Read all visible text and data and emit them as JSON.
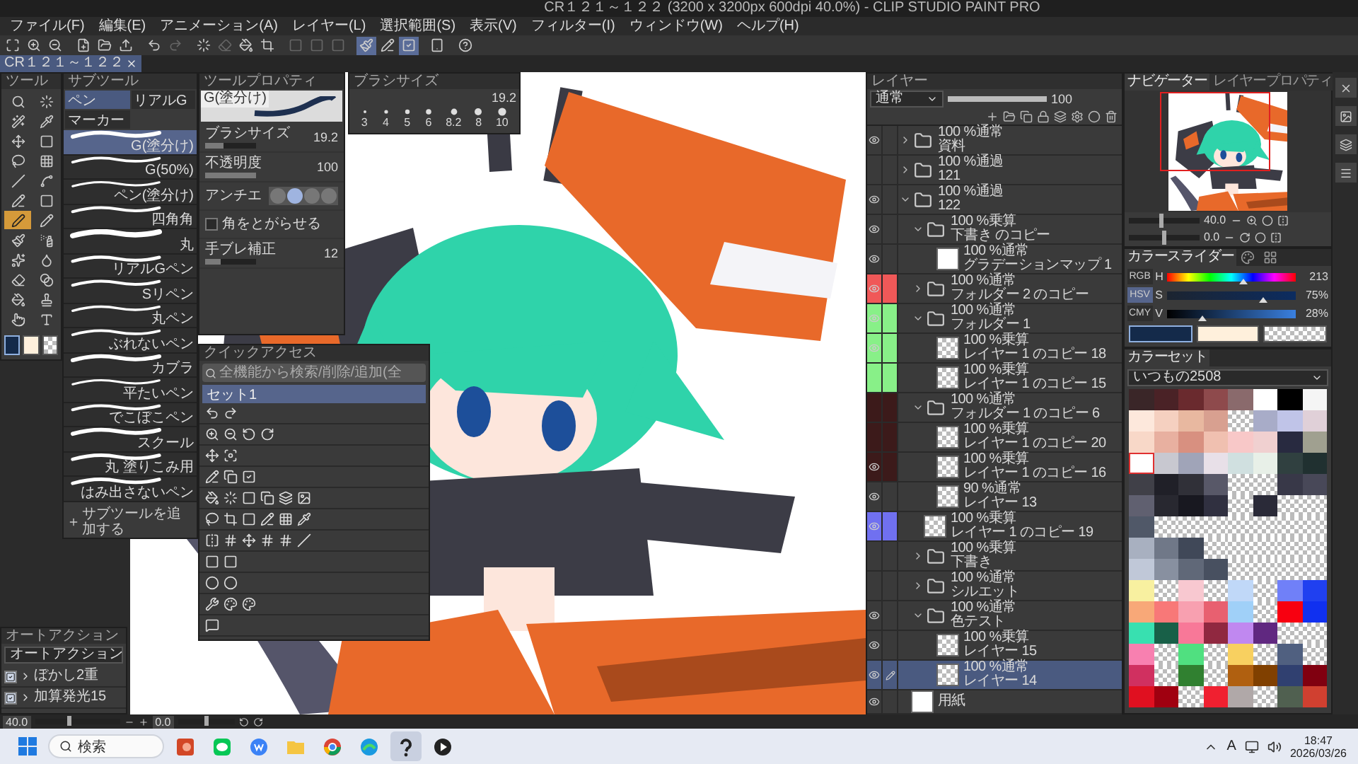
{
  "window": {
    "title": "CR１２１～１２２ (3200 x 3200px 600dpi 40.0%) - CLIP STUDIO PAINT PRO"
  },
  "menu": [
    "ファイル(F)",
    "編集(E)",
    "アニメーション(A)",
    "レイヤー(L)",
    "選択範囲(S)",
    "表示(V)",
    "フィルター(I)",
    "ウィンドウ(W)",
    "ヘルプ(H)"
  ],
  "toolbar": [
    {
      "on": false,
      "disabled": false
    },
    {
      "on": false,
      "disabled": false
    },
    {
      "on": false,
      "disabled": false
    },
    {
      "on": false,
      "disabled": false
    },
    {
      "on": false,
      "disabled": false
    },
    {
      "on": false,
      "disabled": false
    },
    {
      "on": false,
      "disabled": false
    },
    {
      "on": false,
      "disabled": true
    },
    {
      "on": false,
      "disabled": false
    },
    {
      "on": false,
      "disabled": true
    },
    {
      "on": false,
      "disabled": false
    },
    {
      "on": false,
      "disabled": false
    },
    {
      "on": false,
      "disabled": true
    },
    {
      "on": false,
      "disabled": true
    },
    {
      "on": false,
      "disabled": true
    },
    {
      "on": true,
      "disabled": false
    },
    {
      "on": false,
      "disabled": false
    },
    {
      "on": true,
      "disabled": false
    },
    {
      "on": false,
      "disabled": false
    },
    {
      "on": false,
      "disabled": false
    }
  ],
  "document_tab": {
    "label": "CR１２１～１２２",
    "selected": true
  },
  "tool_panel": {
    "title": "ツール",
    "tools": [
      {
        "selected": false
      },
      {
        "selected": false
      },
      {
        "selected": false
      },
      {
        "selected": false
      },
      {
        "selected": false
      },
      {
        "selected": false
      },
      {
        "selected": false
      },
      {
        "selected": false
      },
      {
        "selected": false
      },
      {
        "selected": false
      },
      {
        "selected": false
      },
      {
        "selected": false
      },
      {
        "selected": true
      },
      {
        "selected": false
      },
      {
        "selected": false
      },
      {
        "selected": false
      },
      {
        "selected": false
      },
      {
        "selected": false
      },
      {
        "selected": false
      },
      {
        "selected": false
      },
      {
        "selected": false
      },
      {
        "selected": false
      },
      {
        "selected": false
      },
      {
        "selected": false
      }
    ],
    "colors": [
      {
        "kind": "main",
        "color": "#142a4a",
        "selected": true
      },
      {
        "kind": "sub",
        "color": "#fff0dc",
        "selected": false
      },
      {
        "kind": "transparent",
        "selected": false
      }
    ]
  },
  "subtool_panel": {
    "title": "サブツール",
    "tabs": [
      {
        "label": "ペン",
        "selected": true
      },
      {
        "label": "リアルG",
        "selected": false
      },
      {
        "label": "マーカー",
        "selected": false
      }
    ],
    "brushes": [
      {
        "name": "G(塗分け)",
        "selected": true
      },
      {
        "name": "G(50%)",
        "selected": false
      },
      {
        "name": "ペン(塗分け)",
        "selected": false
      },
      {
        "name": "四角角",
        "selected": false
      },
      {
        "name": "丸",
        "selected": false
      },
      {
        "name": "リアルGペン",
        "selected": false
      },
      {
        "name": "Sリペン",
        "selected": false
      },
      {
        "name": "丸ペン",
        "selected": false
      },
      {
        "name": "ぶれないペン",
        "selected": false
      },
      {
        "name": "カブラ",
        "selected": false
      },
      {
        "name": "平たいペン",
        "selected": false
      },
      {
        "name": "でこぼこペン",
        "selected": false
      },
      {
        "name": "スクール",
        "selected": false
      },
      {
        "name": "丸 塗りこみ用",
        "selected": false
      },
      {
        "name": "はみ出さないペン",
        "selected": false
      }
    ],
    "add_button": "サブツールを追加する"
  },
  "tool_property": {
    "title": "ツールプロパティ",
    "brush_name": "G(塗分け)",
    "settings": [
      {
        "kind": "slider",
        "label": "ブラシサイズ",
        "value": "19.2",
        "level": 0.35
      },
      {
        "kind": "slider",
        "label": "不透明度",
        "value": "100",
        "level": 1
      },
      {
        "kind": "antialias",
        "label": "アンチエ",
        "options": [
          {
            "selected": false
          },
          {
            "selected": true
          },
          {
            "selected": false
          },
          {
            "selected": false
          }
        ]
      },
      {
        "kind": "checkbox",
        "label": "角をとがらせる",
        "checked": false
      },
      {
        "kind": "slider",
        "label": "手ブレ補正",
        "value": "12",
        "level": 0.3
      }
    ]
  },
  "brush_size": {
    "title": "ブラシサイズ",
    "current": "19.2",
    "sizes": [
      "3",
      "4",
      "5",
      "6",
      "8.2",
      "8",
      "10"
    ]
  },
  "quick_access": {
    "title": "クイックアクセス",
    "search": {
      "placeholder": "全機能から検索/削除/追加(全"
    },
    "set": {
      "label": "セット1",
      "selected": true
    }
  },
  "auto_action": {
    "title": "オートアクション",
    "set": "オートアクション",
    "actions": [
      {
        "label": "ぼかし2重",
        "checked": true
      },
      {
        "label": "加算発光15",
        "checked": true
      }
    ]
  },
  "layer_panel": {
    "title": "レイヤー",
    "blend_mode": "通常",
    "opacity": {
      "value": "100",
      "level": 1
    },
    "layers": [
      {
        "kind": "folder",
        "mode": "100 %通常",
        "name": "資料",
        "visible": true,
        "expanded": false,
        "selected": false
      },
      {
        "kind": "folder",
        "mode": "100 %通過",
        "name": "121",
        "visible": false,
        "expanded": false,
        "selected": false
      },
      {
        "kind": "folder",
        "mode": "100 %通過",
        "name": "122",
        "visible": true,
        "expanded": true,
        "selected": false,
        "children": [
          {
            "kind": "folder",
            "mode": "100 %乗算",
            "name": "下書き のコピー",
            "visible": true,
            "expanded": true,
            "selected": false,
            "children": [
              {
                "kind": "correction",
                "mode": "100 %通常",
                "name": "グラデーションマップ 1",
                "visible": true,
                "selected": false
              }
            ]
          },
          {
            "kind": "folder",
            "mode": "100 %通常",
            "name": "フォルダー 2 のコピー",
            "visible": true,
            "expanded": false,
            "selected": false,
            "color": "#f05858"
          },
          {
            "kind": "folder",
            "mode": "100 %通常",
            "name": "フォルダー 1",
            "visible": true,
            "expanded": true,
            "selected": false,
            "color": "#88f088",
            "children": [
              {
                "kind": "layer",
                "mode": "100 %乗算",
                "name": "レイヤー 1 のコピー 18",
                "visible": true,
                "selected": false,
                "color": "#88f088"
              },
              {
                "kind": "layer",
                "mode": "100 %乗算",
                "name": "レイヤー 1 のコピー 15",
                "visible": false,
                "selected": false,
                "color": "#88f088"
              }
            ]
          },
          {
            "kind": "folder",
            "mode": "100 %通常",
            "name": "フォルダー 1 のコピー 6",
            "visible": false,
            "expanded": true,
            "selected": false,
            "color": "#3c1a1a",
            "children": [
              {
                "kind": "layer",
                "mode": "100 %乗算",
                "name": "レイヤー 1 のコピー 20",
                "visible": false,
                "selected": false,
                "color": "#3c1a1a"
              },
              {
                "kind": "layer",
                "mode": "100 %乗算",
                "name": "レイヤー 1 のコピー 16",
                "visible": true,
                "selected": false,
                "color": "#3c1a1a"
              },
              {
                "kind": "layer",
                "mode": "90 %通常",
                "name": "レイヤー 13",
                "visible": true,
                "selected": false
              }
            ]
          },
          {
            "kind": "layer",
            "mode": "100 %乗算",
            "name": "レイヤー 1 のコピー 19",
            "visible": true,
            "selected": false,
            "color": "#7070f0"
          },
          {
            "kind": "folder",
            "mode": "100 %乗算",
            "name": "下書き",
            "visible": false,
            "expanded": false,
            "selected": false
          },
          {
            "kind": "folder",
            "mode": "100 %通常",
            "name": "シルエット",
            "visible": false,
            "expanded": false,
            "selected": false
          },
          {
            "kind": "folder",
            "mode": "100 %通常",
            "name": "色テスト",
            "visible": true,
            "expanded": true,
            "selected": false,
            "children": [
              {
                "kind": "layer",
                "mode": "100 %乗算",
                "name": "レイヤー 15",
                "visible": true,
                "selected": false
              },
              {
                "kind": "layer",
                "mode": "100 %通常",
                "name": "レイヤー 14",
                "visible": true,
                "selected": true
              }
            ]
          }
        ]
      },
      {
        "kind": "paper",
        "name": "用紙",
        "visible": true,
        "selected": false
      }
    ]
  },
  "navigator": {
    "tabs": [
      {
        "label": "ナビゲーター",
        "selected": true
      },
      {
        "label": "レイヤープロパティ",
        "selected": false
      }
    ],
    "zoom": {
      "value": "40.0",
      "level": 0.45
    },
    "angle": {
      "value": "0.0",
      "level": 0.5
    }
  },
  "color_slider": {
    "tab": "カラースライダー",
    "modes": [
      {
        "label": "RGB",
        "selected": false
      },
      {
        "label": "HSV",
        "selected": true
      },
      {
        "label": "CMY",
        "selected": false
      }
    ],
    "channels": [
      {
        "kind": "hue",
        "label": "H",
        "value": "213",
        "level": 0.59
      },
      {
        "kind": "saturation",
        "label": "S",
        "value": "75%",
        "level": 0.75
      },
      {
        "kind": "value",
        "label": "V",
        "value": "28%",
        "level": 0.28
      }
    ],
    "chips": [
      {
        "kind": "main",
        "color": "#142a4a",
        "selected": true
      },
      {
        "kind": "sub",
        "color": "#fff0dc",
        "selected": false
      },
      {
        "kind": "transparent",
        "selected": false
      }
    ]
  },
  "color_set": {
    "tab": "カラーセット",
    "set_name": "いつもの2508",
    "rows": [
      {
        "swatches": [
          {
            "kind": "solid",
            "color": "#3a2628",
            "selected": false
          },
          {
            "kind": "solid",
            "color": "#4a2226",
            "selected": false
          },
          {
            "kind": "solid",
            "color": "#6a2a2e",
            "selected": false
          },
          {
            "kind": "solid",
            "color": "#8e4a4c",
            "selected": false
          },
          {
            "kind": "solid",
            "color": "#8a6a6c",
            "selected": false
          },
          {
            "kind": "solid",
            "color": "#ffffff",
            "selected": false
          },
          {
            "kind": "solid",
            "color": "#000000",
            "selected": false
          },
          {
            "kind": "solid",
            "color": "#f5f5f5",
            "selected": false
          }
        ]
      },
      {
        "swatches": [
          {
            "kind": "solid",
            "color": "#fde8dc",
            "selected": false
          },
          {
            "kind": "solid",
            "color": "#f5d0c0",
            "selected": false
          },
          {
            "kind": "solid",
            "color": "#e8b8a0",
            "selected": false
          },
          {
            "kind": "solid",
            "color": "#d8a090",
            "selected": false
          },
          {
            "kind": "clear",
            "selected": false
          },
          {
            "kind": "solid",
            "color": "#a8acc8",
            "selected": false
          },
          {
            "kind": "solid",
            "color": "#c0c4e8",
            "selected": false
          },
          {
            "kind": "solid",
            "color": "#e0d0d8",
            "selected": false
          }
        ]
      },
      {
        "swatches": [
          {
            "kind": "solid",
            "color": "#f8d8c8",
            "selected": false
          },
          {
            "kind": "solid",
            "color": "#e8b0a0",
            "selected": false
          },
          {
            "kind": "solid",
            "color": "#d89080",
            "selected": false
          },
          {
            "kind": "solid",
            "color": "#f0c0b0",
            "selected": false
          },
          {
            "kind": "solid",
            "color": "#f8c8c8",
            "selected": false
          },
          {
            "kind": "solid",
            "color": "#f0d0d0",
            "selected": false
          },
          {
            "kind": "solid",
            "color": "#282a40",
            "selected": false
          },
          {
            "kind": "solid",
            "color": "#a0a090",
            "selected": false
          }
        ]
      },
      {
        "swatches": [
          {
            "kind": "solid",
            "color": "#ffffff",
            "selected": true
          },
          {
            "kind": "solid",
            "color": "#c8c8d0",
            "selected": false
          },
          {
            "kind": "solid",
            "color": "#a0a4b8",
            "selected": false
          },
          {
            "kind": "solid",
            "color": "#e8e0e8",
            "selected": false
          },
          {
            "kind": "solid",
            "color": "#d0e0e0",
            "selected": false
          },
          {
            "kind": "solid",
            "color": "#e8f0e8",
            "selected": false
          },
          {
            "kind": "solid",
            "color": "#304040",
            "selected": false
          },
          {
            "kind": "solid",
            "color": "#203030",
            "selected": false
          }
        ]
      },
      {
        "swatches": [
          {
            "kind": "solid",
            "color": "#404048",
            "selected": false
          },
          {
            "kind": "solid",
            "color": "#202028",
            "selected": false
          },
          {
            "kind": "solid",
            "color": "#303038",
            "selected": false
          },
          {
            "kind": "solid",
            "color": "#585868",
            "selected": false
          },
          {
            "kind": "clear",
            "selected": false
          },
          {
            "kind": "clear",
            "selected": false
          },
          {
            "kind": "solid",
            "color": "#383848",
            "selected": false
          },
          {
            "kind": "solid",
            "color": "#484858",
            "selected": false
          }
        ]
      },
      {
        "swatches": [
          {
            "kind": "solid",
            "color": "#606070",
            "selected": false
          },
          {
            "kind": "solid",
            "color": "#282830",
            "selected": false
          },
          {
            "kind": "solid",
            "color": "#181820",
            "selected": false
          },
          {
            "kind": "solid",
            "color": "#303040",
            "selected": false
          },
          {
            "kind": "clear",
            "selected": false
          },
          {
            "kind": "solid",
            "color": "#2a2a38",
            "selected": false
          },
          {
            "kind": "clear",
            "selected": false
          },
          {
            "kind": "clear",
            "selected": false
          }
        ]
      },
      {
        "swatches": [
          {
            "kind": "solid",
            "color": "#505868",
            "selected": false
          },
          {
            "kind": "clear",
            "selected": false
          },
          {
            "kind": "clear",
            "selected": false
          },
          {
            "kind": "clear",
            "selected": false
          },
          {
            "kind": "clear",
            "selected": false
          },
          {
            "kind": "clear",
            "selected": false
          },
          {
            "kind": "clear",
            "selected": false
          },
          {
            "kind": "clear",
            "selected": false
          }
        ]
      },
      {
        "swatches": [
          {
            "kind": "solid",
            "color": "#a8b0c0",
            "selected": false
          },
          {
            "kind": "solid",
            "color": "#707888",
            "selected": false
          },
          {
            "kind": "solid",
            "color": "#404858",
            "selected": false
          },
          {
            "kind": "clear",
            "selected": false
          },
          {
            "kind": "clear",
            "selected": false
          },
          {
            "kind": "clear",
            "selected": false
          },
          {
            "kind": "clear",
            "selected": false
          },
          {
            "kind": "clear",
            "selected": false
          }
        ]
      },
      {
        "swatches": [
          {
            "kind": "solid",
            "color": "#c0c8d8",
            "selected": false
          },
          {
            "kind": "solid",
            "color": "#8890a0",
            "selected": false
          },
          {
            "kind": "solid",
            "color": "#606878",
            "selected": false
          },
          {
            "kind": "solid",
            "color": "#485060",
            "selected": false
          },
          {
            "kind": "clear",
            "selected": false
          },
          {
            "kind": "clear",
            "selected": false
          },
          {
            "kind": "clear",
            "selected": false
          },
          {
            "kind": "clear",
            "selected": false
          }
        ]
      },
      {
        "swatches": [
          {
            "kind": "solid",
            "color": "#f8f0a0",
            "selected": false
          },
          {
            "kind": "clear",
            "selected": false
          },
          {
            "kind": "solid",
            "color": "#f8c8d0",
            "selected": false
          },
          {
            "kind": "clear",
            "selected": false
          },
          {
            "kind": "solid",
            "color": "#c0d8f8",
            "selected": false
          },
          {
            "kind": "clear",
            "selected": false
          },
          {
            "kind": "solid",
            "color": "#7080f8",
            "selected": false
          },
          {
            "kind": "solid",
            "color": "#2040f0",
            "selected": false
          }
        ]
      },
      {
        "swatches": [
          {
            "kind": "solid",
            "color": "#f8a878",
            "selected": false
          },
          {
            "kind": "solid",
            "color": "#f87878",
            "selected": false
          },
          {
            "kind": "solid",
            "color": "#f8a0b0",
            "selected": false
          },
          {
            "kind": "solid",
            "color": "#e86070",
            "selected": false
          },
          {
            "kind": "solid",
            "color": "#a0d0f8",
            "selected": false
          },
          {
            "kind": "clear",
            "selected": false
          },
          {
            "kind": "solid",
            "color": "#f80010",
            "selected": false
          },
          {
            "kind": "solid",
            "color": "#1030f0",
            "selected": false
          }
        ]
      },
      {
        "swatches": [
          {
            "kind": "solid",
            "color": "#38e0b0",
            "selected": false
          },
          {
            "kind": "solid",
            "color": "#186048",
            "selected": false
          },
          {
            "kind": "solid",
            "color": "#f87898",
            "selected": false
          },
          {
            "kind": "solid",
            "color": "#902840",
            "selected": false
          },
          {
            "kind": "solid",
            "color": "#c088f0",
            "selected": false
          },
          {
            "kind": "solid",
            "color": "#602880",
            "selected": false
          },
          {
            "kind": "clear",
            "selected": false
          },
          {
            "kind": "clear",
            "selected": false
          }
        ]
      },
      {
        "swatches": [
          {
            "kind": "solid",
            "color": "#f880b0",
            "selected": false
          },
          {
            "kind": "clear",
            "selected": false
          },
          {
            "kind": "solid",
            "color": "#50e080",
            "selected": false
          },
          {
            "kind": "clear",
            "selected": false
          },
          {
            "kind": "solid",
            "color": "#f8d060",
            "selected": false
          },
          {
            "kind": "clear",
            "selected": false
          },
          {
            "kind": "solid",
            "color": "#506080",
            "selected": false
          },
          {
            "kind": "clear",
            "selected": false
          }
        ]
      },
      {
        "swatches": [
          {
            "kind": "solid",
            "color": "#d03060",
            "selected": false
          },
          {
            "kind": "clear",
            "selected": false
          },
          {
            "kind": "solid",
            "color": "#308030",
            "selected": false
          },
          {
            "kind": "clear",
            "selected": false
          },
          {
            "kind": "solid",
            "color": "#b06010",
            "selected": false
          },
          {
            "kind": "solid",
            "color": "#804000",
            "selected": false
          },
          {
            "kind": "solid",
            "color": "#304070",
            "selected": false
          },
          {
            "kind": "solid",
            "color": "#800010",
            "selected": false
          }
        ]
      },
      {
        "swatches": [
          {
            "kind": "solid",
            "color": "#e01020",
            "selected": false
          },
          {
            "kind": "solid",
            "color": "#a00010",
            "selected": false
          },
          {
            "kind": "clear",
            "selected": false
          },
          {
            "kind": "solid",
            "color": "#f02030",
            "selected": false
          },
          {
            "kind": "solid",
            "color": "#b0a8a8",
            "selected": false
          },
          {
            "kind": "clear",
            "selected": false
          },
          {
            "kind": "solid",
            "color": "#506050",
            "selected": false
          },
          {
            "kind": "solid",
            "color": "#d04030",
            "selected": false
          }
        ]
      }
    ]
  },
  "status_bar": {
    "zoom": {
      "value": "40.0",
      "level": 0.4
    },
    "angle": {
      "value": "0.0",
      "level": 0.5
    }
  },
  "taskbar": {
    "search": "検索",
    "apps": [
      {
        "selected": false
      },
      {
        "selected": false
      },
      {
        "selected": false
      },
      {
        "selected": false
      },
      {
        "selected": false
      },
      {
        "selected": false
      },
      {
        "selected": true
      },
      {
        "selected": false
      }
    ],
    "ime": "A",
    "time": "18:47",
    "date": "2026/03/26"
  }
}
